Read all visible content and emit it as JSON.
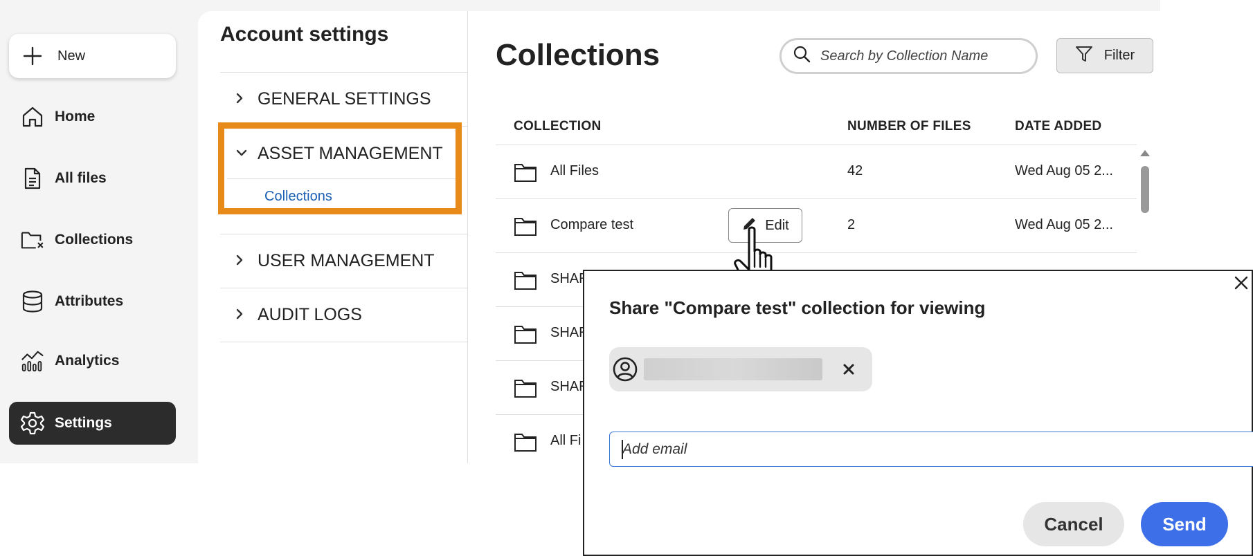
{
  "sidebar": {
    "new_label": "New",
    "items": [
      {
        "label": "Home",
        "icon": "home-icon"
      },
      {
        "label": "All files",
        "icon": "document-icon"
      },
      {
        "label": "Collections",
        "icon": "collections-folder-icon"
      },
      {
        "label": "Attributes",
        "icon": "database-icon"
      },
      {
        "label": "Analytics",
        "icon": "analytics-icon"
      },
      {
        "label": "Settings",
        "icon": "gear-icon",
        "active": true
      }
    ]
  },
  "account_settings": {
    "title": "Account settings",
    "sections": [
      {
        "label": "GENERAL SETTINGS",
        "expanded": false
      },
      {
        "label": "ASSET MANAGEMENT",
        "expanded": true,
        "sub_items": [
          "Collections"
        ]
      },
      {
        "label": "USER MANAGEMENT",
        "expanded": false
      },
      {
        "label": "AUDIT LOGS",
        "expanded": false
      }
    ],
    "highlight_color": "#e88a1a"
  },
  "collections": {
    "title": "Collections",
    "search_placeholder": "Search by Collection Name",
    "filter_label": "Filter",
    "columns": [
      "COLLECTION",
      "NUMBER OF FILES",
      "DATE ADDED"
    ],
    "rows": [
      {
        "name": "All Files",
        "count": "42",
        "date": "Wed Aug 05 2..."
      },
      {
        "name": "Compare test",
        "count": "2",
        "date": "Wed Aug 05 2..."
      },
      {
        "name": "SHAR",
        "count": "",
        "date": ""
      },
      {
        "name": "SHAR",
        "count": "",
        "date": ""
      },
      {
        "name": "SHAR",
        "count": "",
        "date": ""
      },
      {
        "name": "All Fi",
        "count": "",
        "date": ""
      }
    ],
    "edit_label": "Edit"
  },
  "share_dialog": {
    "title": "Share \"Compare test\" collection for viewing",
    "email_placeholder": "Add email",
    "cancel_label": "Cancel",
    "send_label": "Send",
    "send_color": "#3d6fe8"
  }
}
